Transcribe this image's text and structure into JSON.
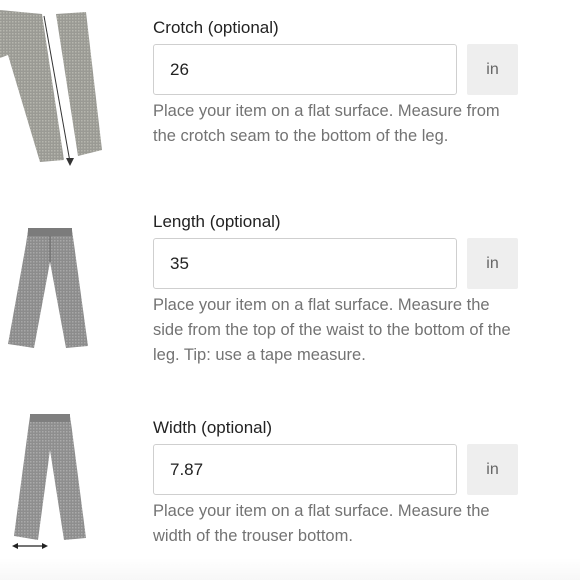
{
  "fields": [
    {
      "label": "Crotch (optional)",
      "value": "26",
      "unit": "in",
      "help": "Place your item on a flat surface. Measure from the crotch seam to the bottom of the leg."
    },
    {
      "label": "Length (optional)",
      "value": "35",
      "unit": "in",
      "help": "Place your item on a flat surface. Measure the side from the top of the waist to the bottom of the leg. Tip: use a tape measure."
    },
    {
      "label": "Width (optional)",
      "value": "7.87",
      "unit": "in",
      "help": "Place your item on a flat surface. Measure the width of the trouser bottom."
    }
  ],
  "icons": {
    "crotch_illustration": "trousers-crotch-measure-icon",
    "length_illustration": "trousers-length-icon",
    "width_illustration": "trousers-width-measure-icon"
  },
  "colors": {
    "unit_bg": "#eeeeee",
    "input_border": "#cfcfcf",
    "help_text": "#737373"
  }
}
